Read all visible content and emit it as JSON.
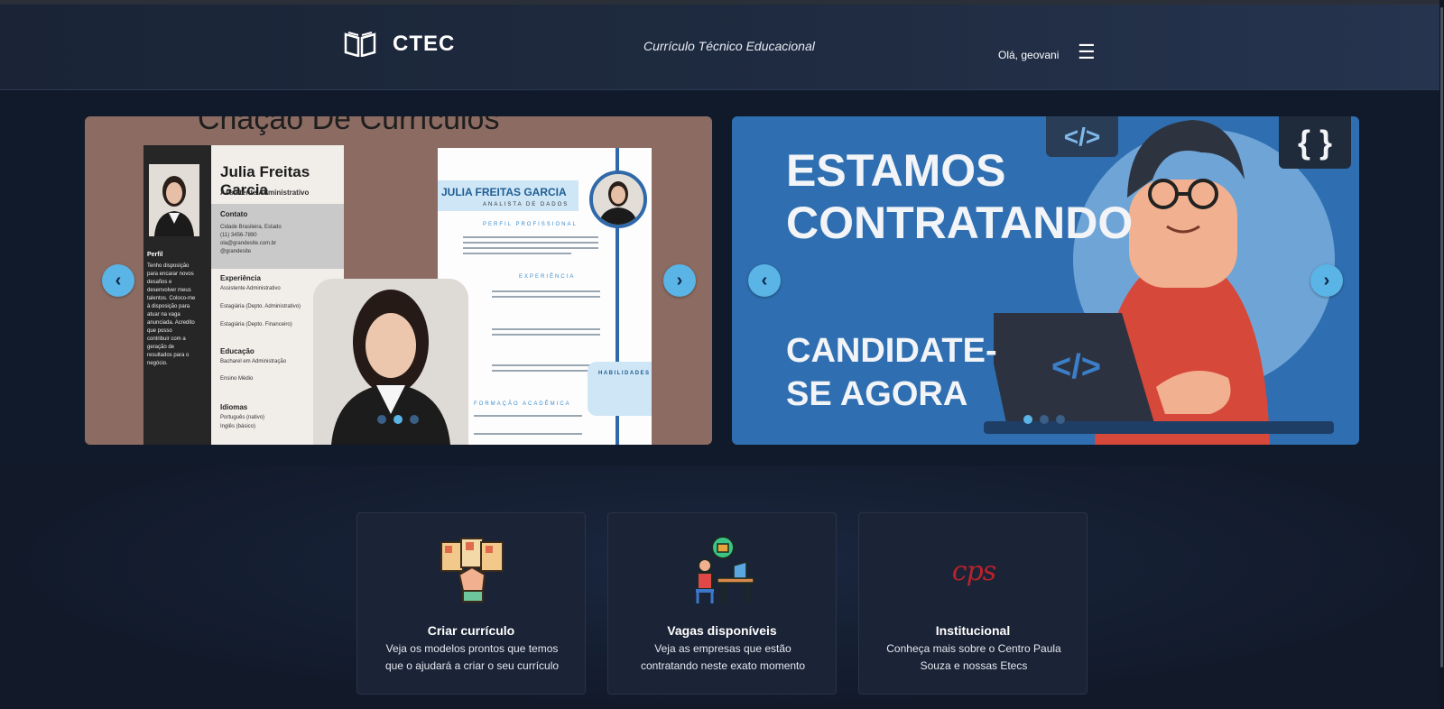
{
  "header": {
    "app_name": "CTEC",
    "tagline": "Currículo Técnico Educacional",
    "greeting": "Olá, geovani",
    "menu_icon": "hamburger-icon"
  },
  "carousel_left": {
    "title_peek": "Criação De Currículos",
    "resume1": {
      "name": "Julia Freitas Garcia",
      "role": "Assistente Administrativo",
      "contact_title": "Contato",
      "contact_lines": [
        "Cidade Brasileira, Estado",
        "(11) 3456-7890",
        "ola@grandesite.com.br",
        "@grandesite"
      ],
      "profile_title": "Perfil",
      "profile_text": "Tenho disposição para encarar novos desafios e desenvolver meus talentos. Coloco-me à disposição para atuar na vaga anunciada. Acredito que posso contribuir com a geração de resultados para o negócio.",
      "experience_title": "Experiência",
      "experience_lines": [
        "Assistente Administrativo",
        "Estagiária (Depto. Administrativo)",
        "Estagiária (Depto. Financeiro)"
      ],
      "education_title": "Educação",
      "education_lines": [
        "Bacharel em Administração",
        "Ensino Médio"
      ],
      "languages_title": "Idiomas",
      "languages_lines": [
        "Português (nativo)",
        "Inglês (básico)"
      ]
    },
    "resume2": {
      "name": "JULIA FREITAS GARCIA",
      "role": "ANALISTA DE DADOS",
      "profile_title": "PERFIL PROFISSIONAL",
      "experience_title": "EXPERIÊNCIA",
      "education_title": "FORMAÇÃO ACADÊMICA",
      "skills_title": "HABILIDADES"
    },
    "prev_label": "‹",
    "next_label": "›"
  },
  "carousel_right": {
    "headline": "ESTAMOS CONTRATANDO",
    "cta": "CANDIDATE-SE AGORA",
    "code_tag": "</>",
    "braces": "{ }",
    "prev_label": "‹",
    "next_label": "›"
  },
  "cards": [
    {
      "title": "Criar currículo",
      "description": "Veja os modelos prontos que temos que o ajudará a criar o seu currículo",
      "icon": "resume-hand-icon"
    },
    {
      "title": "Vagas disponíveis",
      "description": "Veja as empresas que estão contratando neste exato momento",
      "icon": "job-desk-icon"
    },
    {
      "title": "Institucional",
      "description": "Conheça mais sobre o Centro Paula Souza e nossas Etecs",
      "icon": "cps-logo-icon",
      "icon_text": "cps"
    }
  ],
  "colors": {
    "accent": "#5ab4e6",
    "header_bg": "#1f2b40",
    "page_bg": "#111a2a",
    "card_bg": "#1b2336",
    "cps_red": "#b8232b"
  }
}
